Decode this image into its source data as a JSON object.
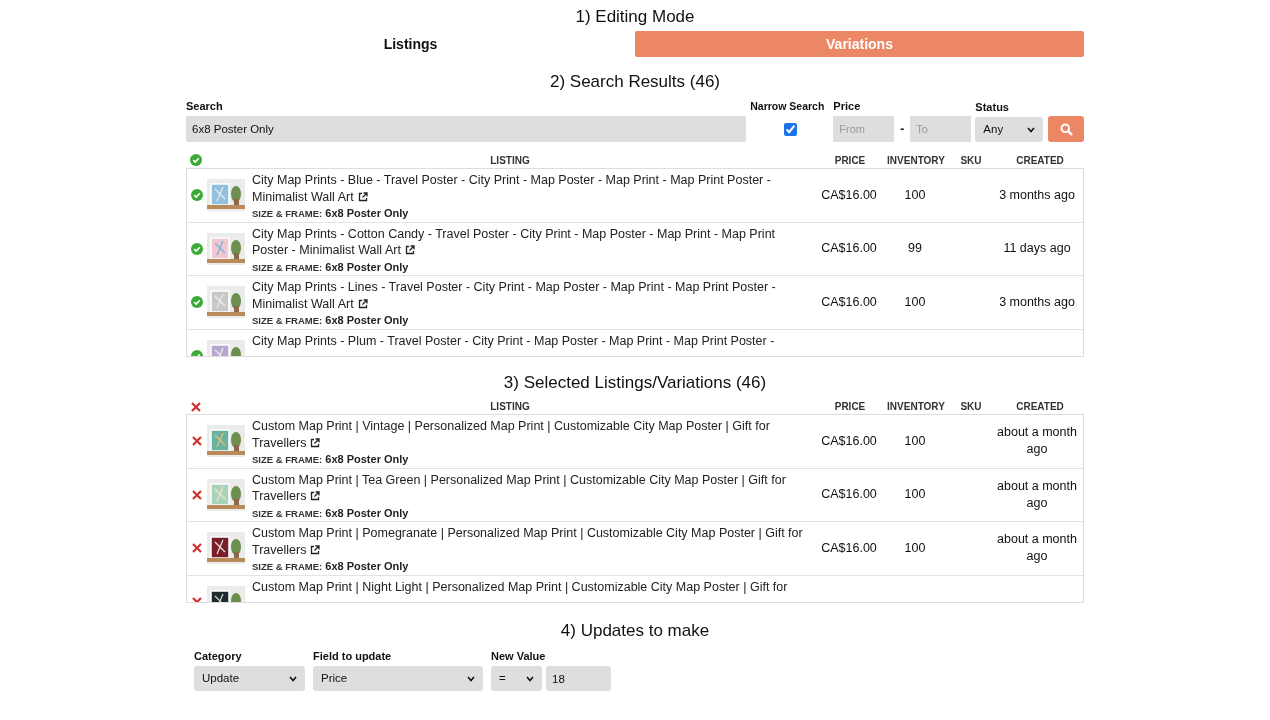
{
  "section_1": {
    "heading": "1) Editing Mode",
    "modes": [
      {
        "label": "Listings",
        "selected": false
      },
      {
        "label": "Variations",
        "selected": true
      }
    ]
  },
  "section_2": {
    "heading": "2) Search Results (46)",
    "search": {
      "label": "Search",
      "value": "6x8 Poster Only"
    },
    "narrow_search": {
      "label": "Narrow Search",
      "checked": true
    },
    "price": {
      "label": "Price",
      "from_placeholder": "From",
      "separator": "-",
      "to_placeholder": "To"
    },
    "status": {
      "label": "Status",
      "value": "Any"
    },
    "columns": [
      "LISTING",
      "PRICE",
      "INVENTORY",
      "SKU",
      "CREATED"
    ],
    "rows": [
      {
        "title": "City Map Prints - Blue - Travel Poster - City Print - Map Poster - Map Print - Map Print Poster - Minimalist Wall Art",
        "option_label": "SIZE & FRAME:",
        "option_value": "6x8 Poster Only",
        "price": "CA$16.00",
        "inventory": "100",
        "created": "3 months ago"
      },
      {
        "title": "City Map Prints - Cotton Candy - Travel Poster - City Print - Map Poster - Map Print - Map Print Poster - Minimalist Wall Art",
        "option_label": "SIZE & FRAME:",
        "option_value": "6x8 Poster Only",
        "price": "CA$16.00",
        "inventory": "99",
        "created": "11 days ago"
      },
      {
        "title": "City Map Prints - Lines - Travel Poster - City Print - Map Poster - Map Print - Map Print Poster - Minimalist Wall Art",
        "option_label": "SIZE & FRAME:",
        "option_value": "6x8 Poster Only",
        "price": "CA$16.00",
        "inventory": "100",
        "created": "3 months ago"
      },
      {
        "title": "City Map Prints - Plum - Travel Poster - City Print - Map Poster - Map Print - Map Print Poster -",
        "option_label": "",
        "option_value": "",
        "price": "",
        "inventory": "",
        "created": ""
      }
    ]
  },
  "section_3": {
    "heading": "3) Selected Listings/Variations (46)",
    "columns": [
      "LISTING",
      "PRICE",
      "INVENTORY",
      "SKU",
      "CREATED"
    ],
    "rows": [
      {
        "title": "Custom Map Print | Vintage | Personalized Map Print | Customizable City Map Poster | Gift for Travellers",
        "option_label": "SIZE & FRAME:",
        "option_value": "6x8 Poster Only",
        "price": "CA$16.00",
        "inventory": "100",
        "created": "about a month ago"
      },
      {
        "title": "Custom Map Print | Tea Green | Personalized Map Print | Customizable City Map Poster | Gift for Travellers",
        "option_label": "SIZE & FRAME:",
        "option_value": "6x8 Poster Only",
        "price": "CA$16.00",
        "inventory": "100",
        "created": "about a month ago"
      },
      {
        "title": "Custom Map Print | Pomegranate | Personalized Map Print | Customizable City Map Poster | Gift for Travellers",
        "option_label": "SIZE & FRAME:",
        "option_value": "6x8 Poster Only",
        "price": "CA$16.00",
        "inventory": "100",
        "created": "about a month ago"
      },
      {
        "title": "Custom Map Print | Night Light | Personalized Map Print | Customizable City Map Poster | Gift for",
        "option_label": "",
        "option_value": "",
        "price": "",
        "inventory": "",
        "created": ""
      }
    ]
  },
  "section_4": {
    "heading": "4) Updates to make",
    "category": {
      "label": "Category",
      "value": "Update"
    },
    "field": {
      "label": "Field to update",
      "value": "Price"
    },
    "new_value": {
      "label": "New Value",
      "operator": "=",
      "value": "18"
    }
  }
}
